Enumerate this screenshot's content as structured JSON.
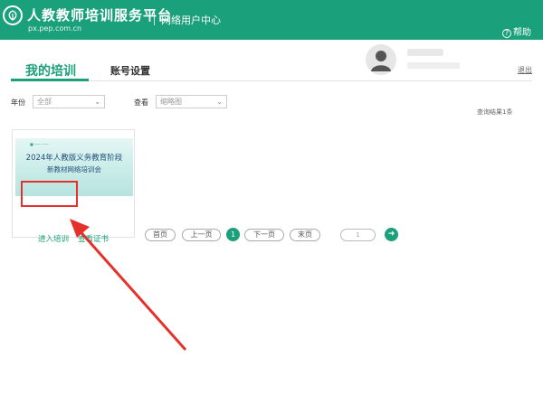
{
  "header": {
    "brand": "人教教师培训服务平台",
    "url": "px.pep.com.cn",
    "subtitle": "网络用户中心",
    "help_label": "帮助",
    "help_icon": "question-circle-icon",
    "logo_icon": "leaf-logo-icon"
  },
  "tabs": {
    "training": "我的培训",
    "account": "账号设置"
  },
  "user": {
    "logout": "退出"
  },
  "filters": {
    "year_label": "年份",
    "year_value": "全部",
    "view_label": "查看",
    "view_value": "缩略图",
    "result_text": "查询结果1条"
  },
  "course": {
    "thumb_title_line1": "2024年人教版义务教育阶段",
    "thumb_title_line2": "新教材网络培训会",
    "enter_label": "进入培训",
    "cert_label": "查看证书"
  },
  "pagination": {
    "first": "首页",
    "prev": "上一页",
    "current": "1",
    "next": "下一页",
    "last": "末页",
    "input_value": "1",
    "go_icon": "arrow-right-circle-icon"
  },
  "colors": {
    "brand": "#1aa07a",
    "highlight": "#e5312b"
  }
}
